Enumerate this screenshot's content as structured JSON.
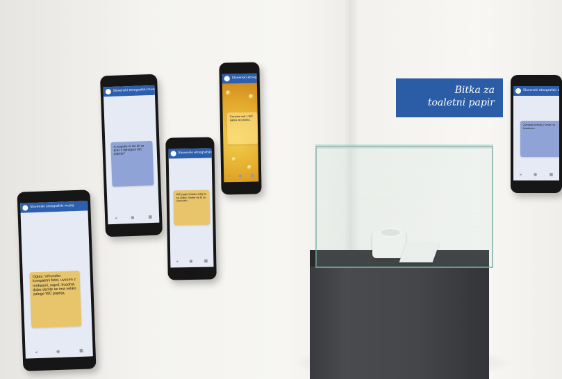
{
  "exhibit": {
    "sign_line1": "Bitka za",
    "sign_line2": "toaletni papir"
  },
  "phones": {
    "app_name": "Slovenski etnografski muzej",
    "phone1": {
      "message": "Oglas: Vrhunsko kompaktni fotel, uvezen z mokasini, napol, kvadrat, dobe denite se ima veliko zaloge WC papirja."
    },
    "phone2": {
      "message": "A mogoče ni ste ali se prav v dahtrgoni WC papirja?"
    },
    "phone3": {
      "message": "WC papir imamo zdaj ko ne vidim. Same ne bi se zavezalo."
    },
    "phone4": {
      "message": "Grozdne sok z WC palico ali praska."
    },
    "phone5": {
      "message": "Zvezala dohrati v vrste na kvaderno."
    }
  },
  "colors": {
    "app_bar": "#2c5fae",
    "bubble_blue": "#8fa3d6",
    "bubble_yellow": "#e8c46a",
    "sign_bg": "#2b5ca6"
  }
}
